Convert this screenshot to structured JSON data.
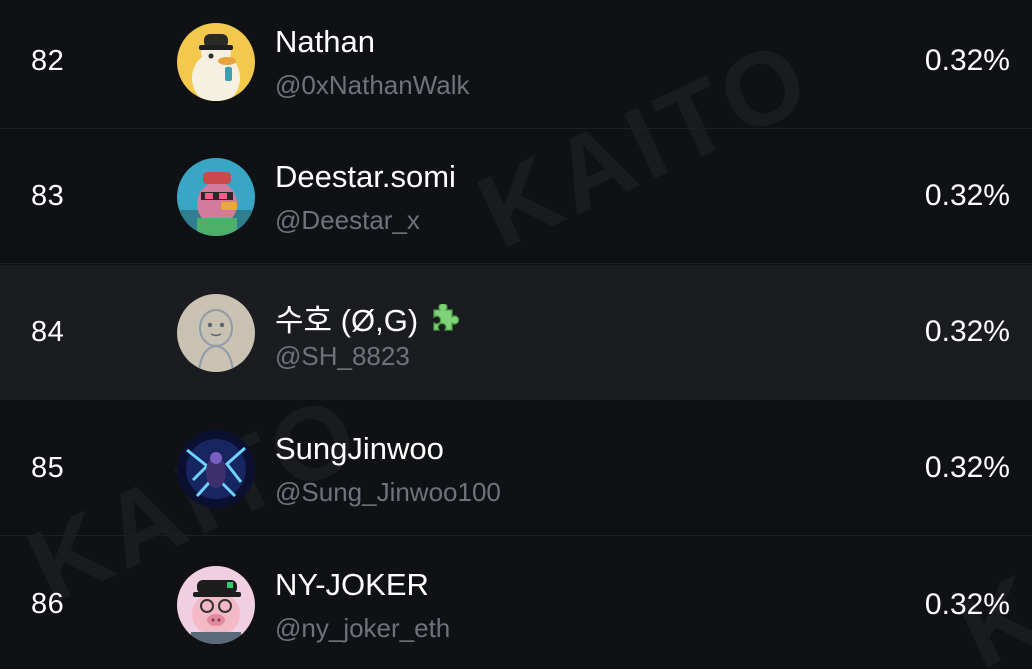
{
  "watermark_text": "KAITO",
  "rows": [
    {
      "rank": "82",
      "name": "Nathan",
      "handle": "@0xNathanWalk",
      "percent": "0.32%",
      "avatar_icon": "yellow-duck-avatar"
    },
    {
      "rank": "83",
      "name": "Deestar.somi",
      "handle": "@Deestar_x",
      "percent": "0.32%",
      "avatar_icon": "pixel-duck-avatar"
    },
    {
      "rank": "84",
      "name": "수호 (Ø,G)",
      "handle": "@SH_8823",
      "percent": "0.32%",
      "avatar_icon": "sketch-avatar",
      "badge_icon": "puzzle-piece-icon",
      "highlighted": true
    },
    {
      "rank": "85",
      "name": "SungJinwoo",
      "handle": "@Sung_Jinwoo100",
      "percent": "0.32%",
      "avatar_icon": "dark-aura-avatar"
    },
    {
      "rank": "86",
      "name": "NY-JOKER",
      "handle": "@ny_joker_eth",
      "percent": "0.32%",
      "avatar_icon": "pig-avatar"
    }
  ],
  "colors": {
    "background": "#0f1114",
    "highlight_row": "#1a1c20",
    "handle_text": "#6e737b",
    "badge_green": "#7fd17a"
  }
}
